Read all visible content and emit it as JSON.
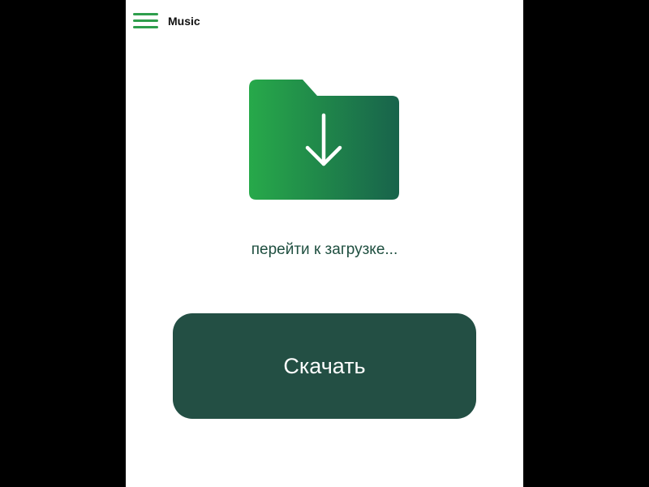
{
  "header": {
    "menu_icon": "hamburger-menu-icon",
    "title": "Music"
  },
  "hero": {
    "icon": "folder-download-icon",
    "gradient_start": "#27a94a",
    "gradient_end": "#18634b"
  },
  "status": {
    "text": "перейти к загрузке..."
  },
  "actions": {
    "download_label": "Скачать",
    "download_color": "#234f44"
  },
  "colors": {
    "accent": "#2e9e4c",
    "text_dark": "#1f4f40",
    "background": "#ffffff"
  }
}
